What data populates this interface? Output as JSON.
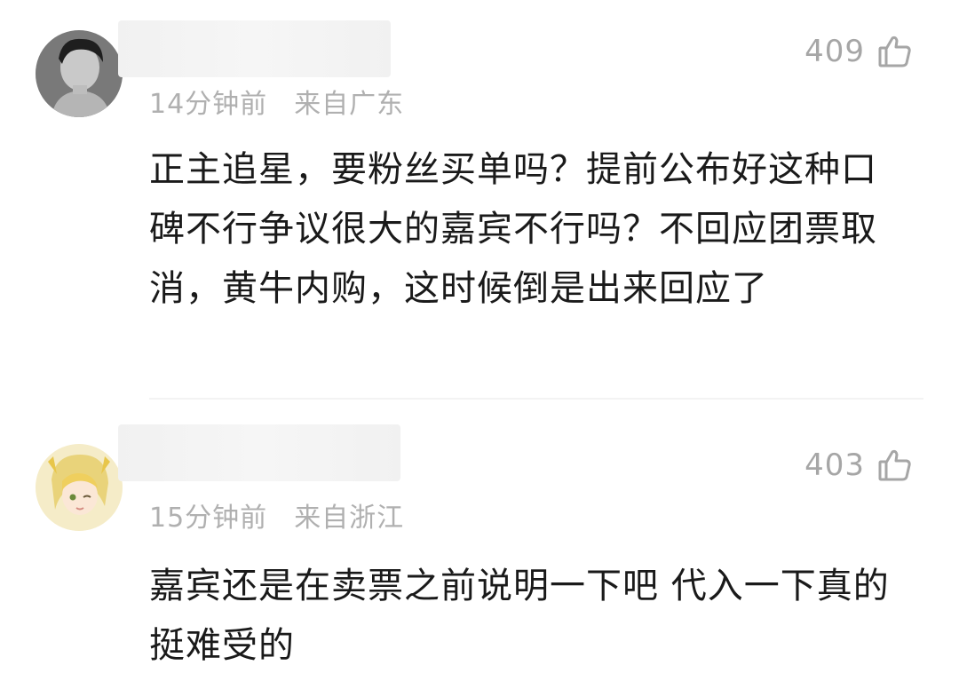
{
  "comments": [
    {
      "time": "14分钟前",
      "location": "来自广东",
      "likes": "409",
      "text": "正主追星，要粉丝买单吗？提前公布好这种口碑不行争议很大的嘉宾不行吗？不回应团票取消，黄牛内购，这时候倒是出来回应了",
      "avatar_icon": "avatar-man-photo-icon"
    },
    {
      "time": "15分钟前",
      "location": "来自浙江",
      "likes": "403",
      "text": "嘉宾还是在卖票之前说明一下吧 代入一下真的挺难受的",
      "avatar_icon": "avatar-anime-girl-icon"
    }
  ],
  "icons": {
    "like": "thumbs-up-outline-icon"
  },
  "colors": {
    "meta_text": "#b0b0b0",
    "like_text": "#a6a6a6",
    "body_text": "#1a1a1a"
  }
}
